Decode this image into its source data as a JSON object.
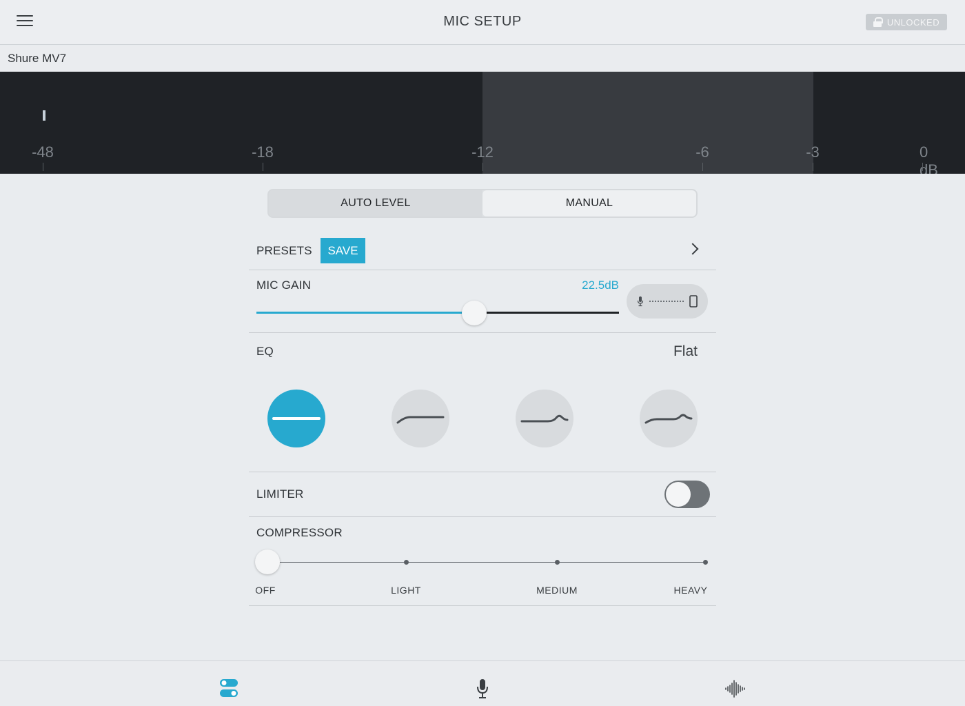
{
  "header": {
    "title": "MIC SETUP",
    "unlocked_label": "UNLOCKED"
  },
  "device": {
    "name": "Shure MV7"
  },
  "meter": {
    "ticks": [
      "-48",
      "-18",
      "-12",
      "-6",
      "-3",
      "0 dB"
    ],
    "level_db": -48
  },
  "mode": {
    "options": [
      "AUTO LEVEL",
      "MANUAL"
    ],
    "selected": "MANUAL"
  },
  "presets": {
    "label": "PRESETS",
    "save_label": "SAVE"
  },
  "mic_gain": {
    "label": "MIC GAIN",
    "value_text": "22.5dB",
    "value_fraction": 0.6
  },
  "eq": {
    "label": "EQ",
    "selected_text": "Flat",
    "options": [
      "flat-eq-icon",
      "bass-cut-eq-icon",
      "presence-boost-eq-icon",
      "bass-cut-presence-boost-eq-icon"
    ],
    "selected_index": 0
  },
  "limiter": {
    "label": "LIMITER",
    "enabled": false
  },
  "compressor": {
    "label": "COMPRESSOR",
    "options": [
      "OFF",
      "LIGHT",
      "MEDIUM",
      "HEAVY"
    ],
    "selected": "OFF"
  },
  "bottom_nav": [
    "settings-toggles-icon",
    "microphone-icon",
    "waveform-icon"
  ],
  "colors": {
    "accent": "#27a9cf",
    "meter_bg": "#1f2226"
  }
}
